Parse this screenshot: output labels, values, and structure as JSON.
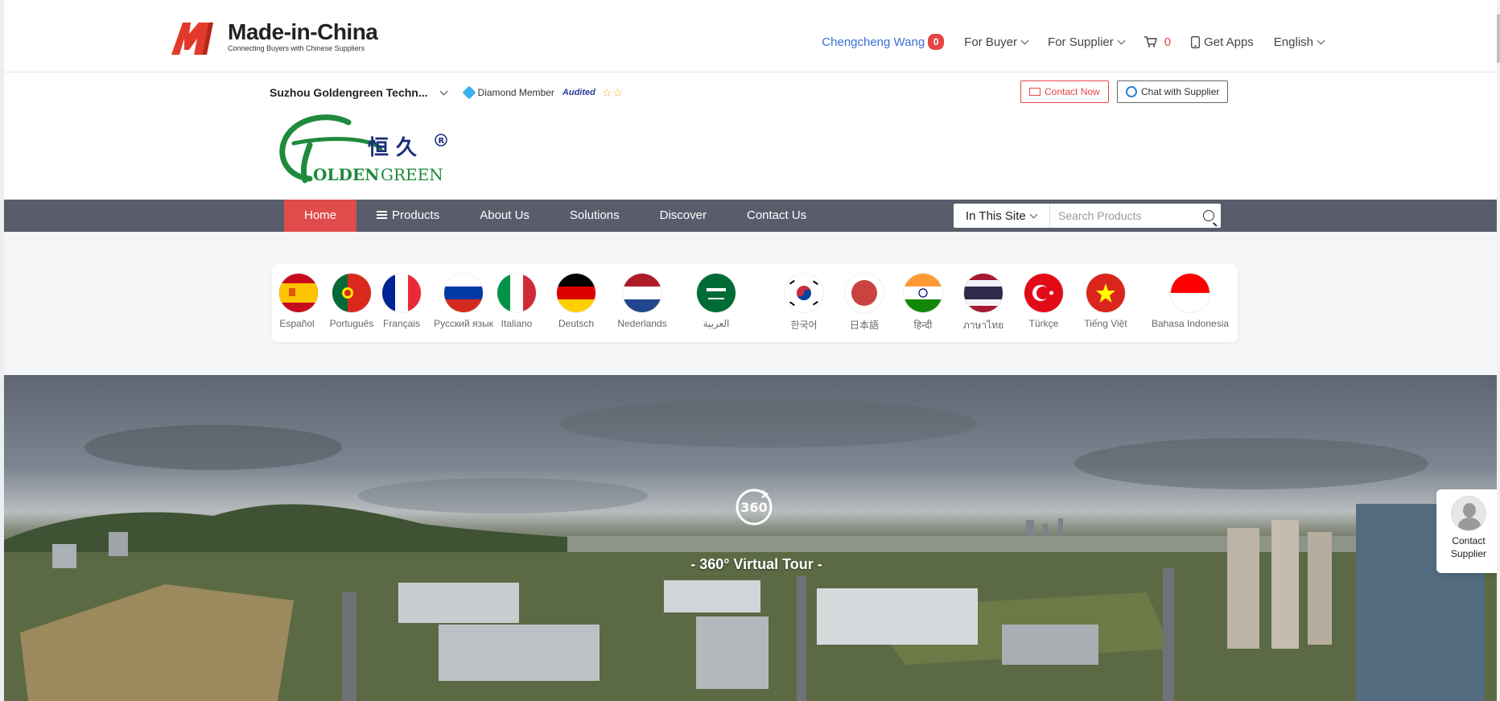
{
  "site": {
    "brand": "Made-in-China",
    "tagline": "Connecting Buyers with Chinese Suppliers",
    "registered": "®"
  },
  "top_nav": {
    "user": "Chengcheng Wang",
    "messages": "0",
    "for_buyer": "For Buyer",
    "for_supplier": "For Supplier",
    "cart_count": "0",
    "get_apps": "Get Apps",
    "language": "English"
  },
  "supplier": {
    "company": "Suzhou Goldengreen Techn...",
    "membership": "Diamond Member",
    "audited": "Audited",
    "stars": "☆☆",
    "contact_now": "Contact Now",
    "chat": "Chat with Supplier",
    "logo_cn": "恒 久",
    "logo_en_a": "OLDEN",
    "logo_en_b": "GREEN"
  },
  "main_nav": {
    "items": [
      "Home",
      "Products",
      "About Us",
      "Solutions",
      "Discover",
      "Contact Us"
    ],
    "scope": "In This Site",
    "search_placeholder": "Search Products"
  },
  "languages": [
    "Español",
    "Português",
    "Français",
    "Русский язык",
    "Italiano",
    "Deutsch",
    "Nederlands",
    "العربية",
    "한국어",
    "日本語",
    "हिन्दी",
    "ภาษาไทย",
    "Türkçe",
    "Tiếng Việt",
    "Bahasa Indonesia"
  ],
  "panorama": {
    "icon_text": "360",
    "label": "- 360° Virtual Tour -"
  },
  "contact_widget": {
    "line1": "Contact",
    "line2": "Supplier"
  },
  "colors": {
    "accent_red": "#e04b4b",
    "nav_bg": "#595d6b",
    "link_blue": "#3a6fd6",
    "brand_green": "#1f8a3d"
  }
}
